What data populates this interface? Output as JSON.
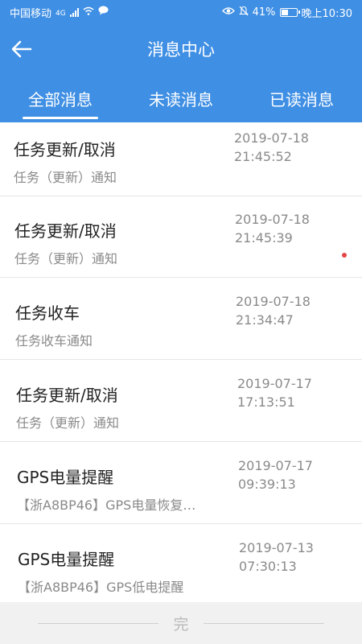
{
  "status_bar": {
    "carrier": "中国移动",
    "network": "4G",
    "battery": "41%",
    "time": "晚上10:30"
  },
  "header": {
    "title": "消息中心"
  },
  "tabs": [
    {
      "label": "全部消息"
    },
    {
      "label": "未读消息"
    },
    {
      "label": "已读消息"
    }
  ],
  "messages": [
    {
      "title": "任务更新/取消",
      "subtitle": "任务（更新）通知",
      "date": "2019-07-18",
      "time": "21:45:52"
    },
    {
      "title": "任务更新/取消",
      "subtitle": "任务（更新）通知",
      "date": "2019-07-18",
      "time": "21:45:39"
    },
    {
      "title": "任务收车",
      "subtitle": "任务收车通知",
      "date": "2019-07-18",
      "time": "21:34:47"
    },
    {
      "title": "任务更新/取消",
      "subtitle": "任务（更新）通知",
      "date": "2019-07-17",
      "time": "17:13:51"
    },
    {
      "title": "GPS电量提醒",
      "subtitle": "【浙A8BP46】GPS电量恢复…",
      "date": "2019-07-17",
      "time": "09:39:13"
    },
    {
      "title": "GPS电量提醒",
      "subtitle": "【浙A8BP46】GPS低电提醒",
      "date": "2019-07-13",
      "time": "07:30:13"
    }
  ],
  "footer": {
    "end_label": "完"
  },
  "colors": {
    "primary": "#3f8fe4",
    "unread_dot": "#e64545"
  }
}
